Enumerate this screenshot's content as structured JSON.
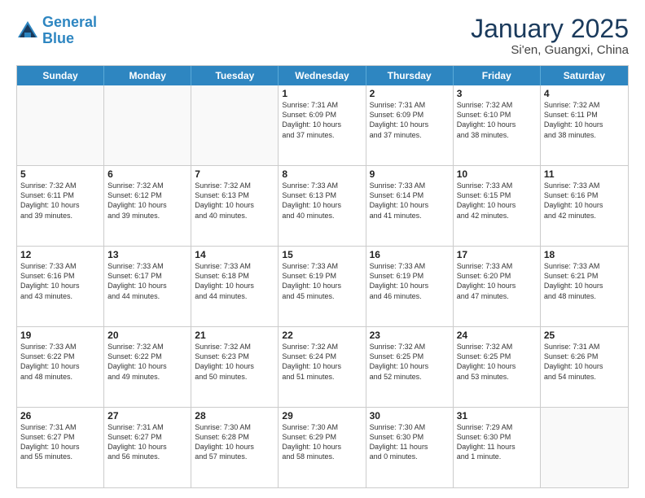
{
  "header": {
    "logo_line1": "General",
    "logo_line2": "Blue",
    "title": "January 2025",
    "subtitle": "Si'en, Guangxi, China"
  },
  "calendar": {
    "days_of_week": [
      "Sunday",
      "Monday",
      "Tuesday",
      "Wednesday",
      "Thursday",
      "Friday",
      "Saturday"
    ],
    "rows": [
      [
        {
          "day": "",
          "info": ""
        },
        {
          "day": "",
          "info": ""
        },
        {
          "day": "",
          "info": ""
        },
        {
          "day": "1",
          "info": "Sunrise: 7:31 AM\nSunset: 6:09 PM\nDaylight: 10 hours\nand 37 minutes."
        },
        {
          "day": "2",
          "info": "Sunrise: 7:31 AM\nSunset: 6:09 PM\nDaylight: 10 hours\nand 37 minutes."
        },
        {
          "day": "3",
          "info": "Sunrise: 7:32 AM\nSunset: 6:10 PM\nDaylight: 10 hours\nand 38 minutes."
        },
        {
          "day": "4",
          "info": "Sunrise: 7:32 AM\nSunset: 6:11 PM\nDaylight: 10 hours\nand 38 minutes."
        }
      ],
      [
        {
          "day": "5",
          "info": "Sunrise: 7:32 AM\nSunset: 6:11 PM\nDaylight: 10 hours\nand 39 minutes."
        },
        {
          "day": "6",
          "info": "Sunrise: 7:32 AM\nSunset: 6:12 PM\nDaylight: 10 hours\nand 39 minutes."
        },
        {
          "day": "7",
          "info": "Sunrise: 7:32 AM\nSunset: 6:13 PM\nDaylight: 10 hours\nand 40 minutes."
        },
        {
          "day": "8",
          "info": "Sunrise: 7:33 AM\nSunset: 6:13 PM\nDaylight: 10 hours\nand 40 minutes."
        },
        {
          "day": "9",
          "info": "Sunrise: 7:33 AM\nSunset: 6:14 PM\nDaylight: 10 hours\nand 41 minutes."
        },
        {
          "day": "10",
          "info": "Sunrise: 7:33 AM\nSunset: 6:15 PM\nDaylight: 10 hours\nand 42 minutes."
        },
        {
          "day": "11",
          "info": "Sunrise: 7:33 AM\nSunset: 6:16 PM\nDaylight: 10 hours\nand 42 minutes."
        }
      ],
      [
        {
          "day": "12",
          "info": "Sunrise: 7:33 AM\nSunset: 6:16 PM\nDaylight: 10 hours\nand 43 minutes."
        },
        {
          "day": "13",
          "info": "Sunrise: 7:33 AM\nSunset: 6:17 PM\nDaylight: 10 hours\nand 44 minutes."
        },
        {
          "day": "14",
          "info": "Sunrise: 7:33 AM\nSunset: 6:18 PM\nDaylight: 10 hours\nand 44 minutes."
        },
        {
          "day": "15",
          "info": "Sunrise: 7:33 AM\nSunset: 6:19 PM\nDaylight: 10 hours\nand 45 minutes."
        },
        {
          "day": "16",
          "info": "Sunrise: 7:33 AM\nSunset: 6:19 PM\nDaylight: 10 hours\nand 46 minutes."
        },
        {
          "day": "17",
          "info": "Sunrise: 7:33 AM\nSunset: 6:20 PM\nDaylight: 10 hours\nand 47 minutes."
        },
        {
          "day": "18",
          "info": "Sunrise: 7:33 AM\nSunset: 6:21 PM\nDaylight: 10 hours\nand 48 minutes."
        }
      ],
      [
        {
          "day": "19",
          "info": "Sunrise: 7:33 AM\nSunset: 6:22 PM\nDaylight: 10 hours\nand 48 minutes."
        },
        {
          "day": "20",
          "info": "Sunrise: 7:32 AM\nSunset: 6:22 PM\nDaylight: 10 hours\nand 49 minutes."
        },
        {
          "day": "21",
          "info": "Sunrise: 7:32 AM\nSunset: 6:23 PM\nDaylight: 10 hours\nand 50 minutes."
        },
        {
          "day": "22",
          "info": "Sunrise: 7:32 AM\nSunset: 6:24 PM\nDaylight: 10 hours\nand 51 minutes."
        },
        {
          "day": "23",
          "info": "Sunrise: 7:32 AM\nSunset: 6:25 PM\nDaylight: 10 hours\nand 52 minutes."
        },
        {
          "day": "24",
          "info": "Sunrise: 7:32 AM\nSunset: 6:25 PM\nDaylight: 10 hours\nand 53 minutes."
        },
        {
          "day": "25",
          "info": "Sunrise: 7:31 AM\nSunset: 6:26 PM\nDaylight: 10 hours\nand 54 minutes."
        }
      ],
      [
        {
          "day": "26",
          "info": "Sunrise: 7:31 AM\nSunset: 6:27 PM\nDaylight: 10 hours\nand 55 minutes."
        },
        {
          "day": "27",
          "info": "Sunrise: 7:31 AM\nSunset: 6:27 PM\nDaylight: 10 hours\nand 56 minutes."
        },
        {
          "day": "28",
          "info": "Sunrise: 7:30 AM\nSunset: 6:28 PM\nDaylight: 10 hours\nand 57 minutes."
        },
        {
          "day": "29",
          "info": "Sunrise: 7:30 AM\nSunset: 6:29 PM\nDaylight: 10 hours\nand 58 minutes."
        },
        {
          "day": "30",
          "info": "Sunrise: 7:30 AM\nSunset: 6:30 PM\nDaylight: 11 hours\nand 0 minutes."
        },
        {
          "day": "31",
          "info": "Sunrise: 7:29 AM\nSunset: 6:30 PM\nDaylight: 11 hours\nand 1 minute."
        },
        {
          "day": "",
          "info": ""
        }
      ]
    ]
  }
}
